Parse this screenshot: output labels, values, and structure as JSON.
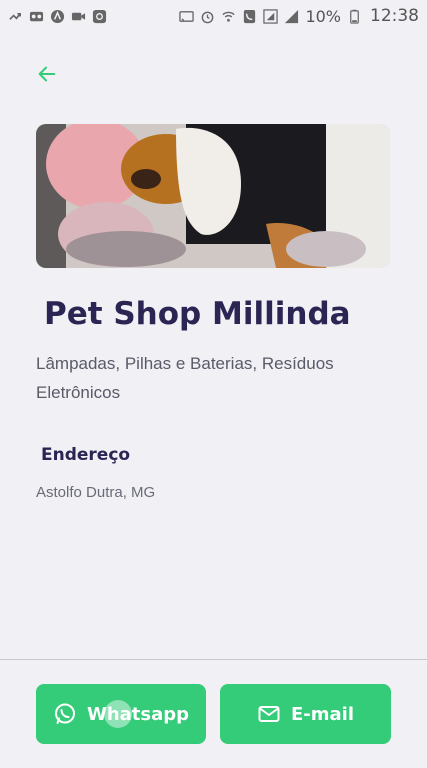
{
  "status_bar": {
    "battery_percent": "10%",
    "time": "12:38",
    "left_icons": [
      "missed-call-icon",
      "voicemail-icon",
      "app-a-icon",
      "video-icon",
      "app-at-icon"
    ],
    "right_icons": [
      "cast-icon",
      "alarm-icon",
      "wifi-call-icon",
      "phone-icon",
      "signal-box-icon",
      "signal-icon",
      "battery-icon"
    ]
  },
  "header": {
    "back_icon": "arrow-left-icon"
  },
  "point": {
    "image_alt": "dog-photo",
    "name": "Pet Shop Millinda",
    "categories": " Lâmpadas, Pilhas e Baterias, Resíduos Eletrônicos",
    "address_label": "Endereço",
    "address_value": "Astolfo Dutra, MG"
  },
  "actions": {
    "whatsapp_label": "Whatsapp",
    "email_label": "E-mail"
  },
  "colors": {
    "primary": "#34cb79",
    "title": "#2a2552",
    "text": "#5a5a68",
    "background": "#f0f0f5"
  }
}
